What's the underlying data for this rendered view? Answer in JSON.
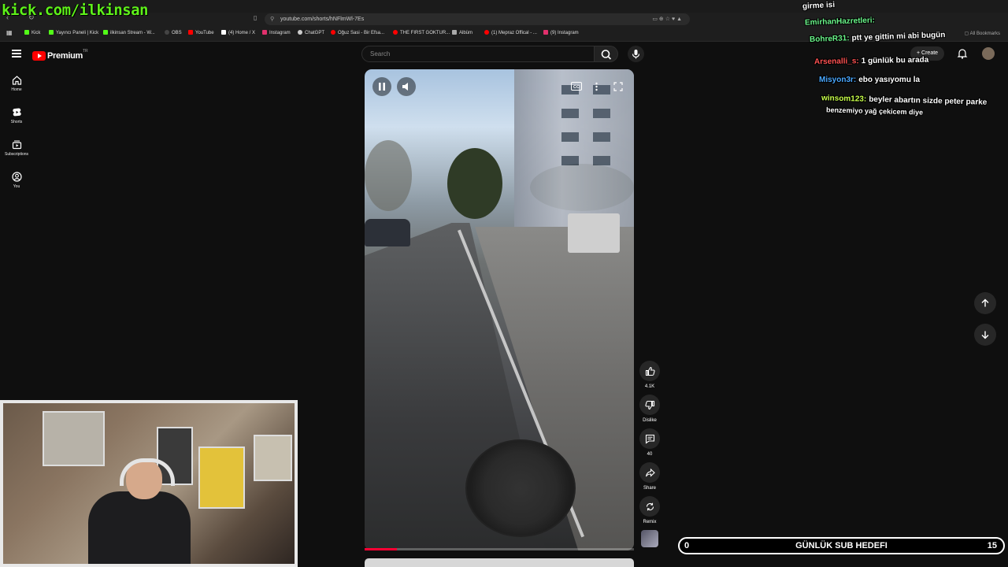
{
  "browser": {
    "url": "youtube.com/shorts/hNFlmWl-7Es",
    "all_bookmarks_label": "All Bookmarks",
    "bookmarks": [
      {
        "label": "Kick",
        "color": "#53fc18"
      },
      {
        "label": "Yayıncı Paneli | Kick",
        "color": "#53fc18"
      },
      {
        "label": "ilkinsan Stream - W...",
        "color": "#53fc18"
      },
      {
        "label": "OBS",
        "color": "#444444"
      },
      {
        "label": "YouTube",
        "color": "#ff0000"
      },
      {
        "label": "(4) Home / X",
        "color": "#ffffff"
      },
      {
        "label": "Instagram",
        "color": "#e1306c"
      },
      {
        "label": "ChatGPT",
        "color": "#cccccc"
      },
      {
        "label": "Oğuz Sasi - Bir Efsa...",
        "color": "#ff0000"
      },
      {
        "label": "THE FIRST GOKTUR...",
        "color": "#ff0000"
      },
      {
        "label": "Albüm",
        "color": "#aaaaaa"
      },
      {
        "label": "(1) Mepraz Offical - ...",
        "color": "#ff0000"
      },
      {
        "label": "(9) Instagram",
        "color": "#e1306c"
      }
    ]
  },
  "overlay": {
    "watermark": "kick.com/ilkinsan"
  },
  "header": {
    "logo_text": "Premium",
    "logo_tm": "TR",
    "search_placeholder": "Search",
    "create_label": "Create"
  },
  "sidebar": {
    "items": [
      {
        "label": "Home",
        "icon": "home-icon"
      },
      {
        "label": "Shorts",
        "icon": "shorts-icon"
      },
      {
        "label": "Subscriptions",
        "icon": "subscriptions-icon"
      },
      {
        "label": "You",
        "icon": "you-icon"
      }
    ]
  },
  "video": {
    "progress": 0.12
  },
  "actions": {
    "like_count": "4.1K",
    "dislike_label": "Dislike",
    "comment_count": "40",
    "share_label": "Share",
    "remix_label": "Remix"
  },
  "chat": {
    "messages": [
      {
        "user": "",
        "text": "girme isi",
        "user_color": "#ffffff"
      },
      {
        "user": "EmirhanHazretleri:",
        "text": "",
        "user_color": "#6af58a"
      },
      {
        "user": "BohreR31:",
        "text": "ptt ye gittin mi abi bugün",
        "user_color": "#6af58a"
      },
      {
        "user": "Arsenalli_s:",
        "text": "1 günlük bu arada",
        "user_color": "#ff5252"
      },
      {
        "user": "Misyon3r:",
        "text": "ebo yasıyomu la",
        "user_color": "#4aa8ff"
      },
      {
        "user": "winsom123:",
        "text": "beyler abartın sizde peter parke",
        "user_color": "#c8ff4a"
      },
      {
        "user": "",
        "text": "benzemiyo yağ çekicem diye",
        "user_color": "#ffffff"
      }
    ]
  },
  "sub_goal": {
    "title": "GÜNLÜK SUB HEDEFI",
    "start": "0",
    "end": "15"
  }
}
